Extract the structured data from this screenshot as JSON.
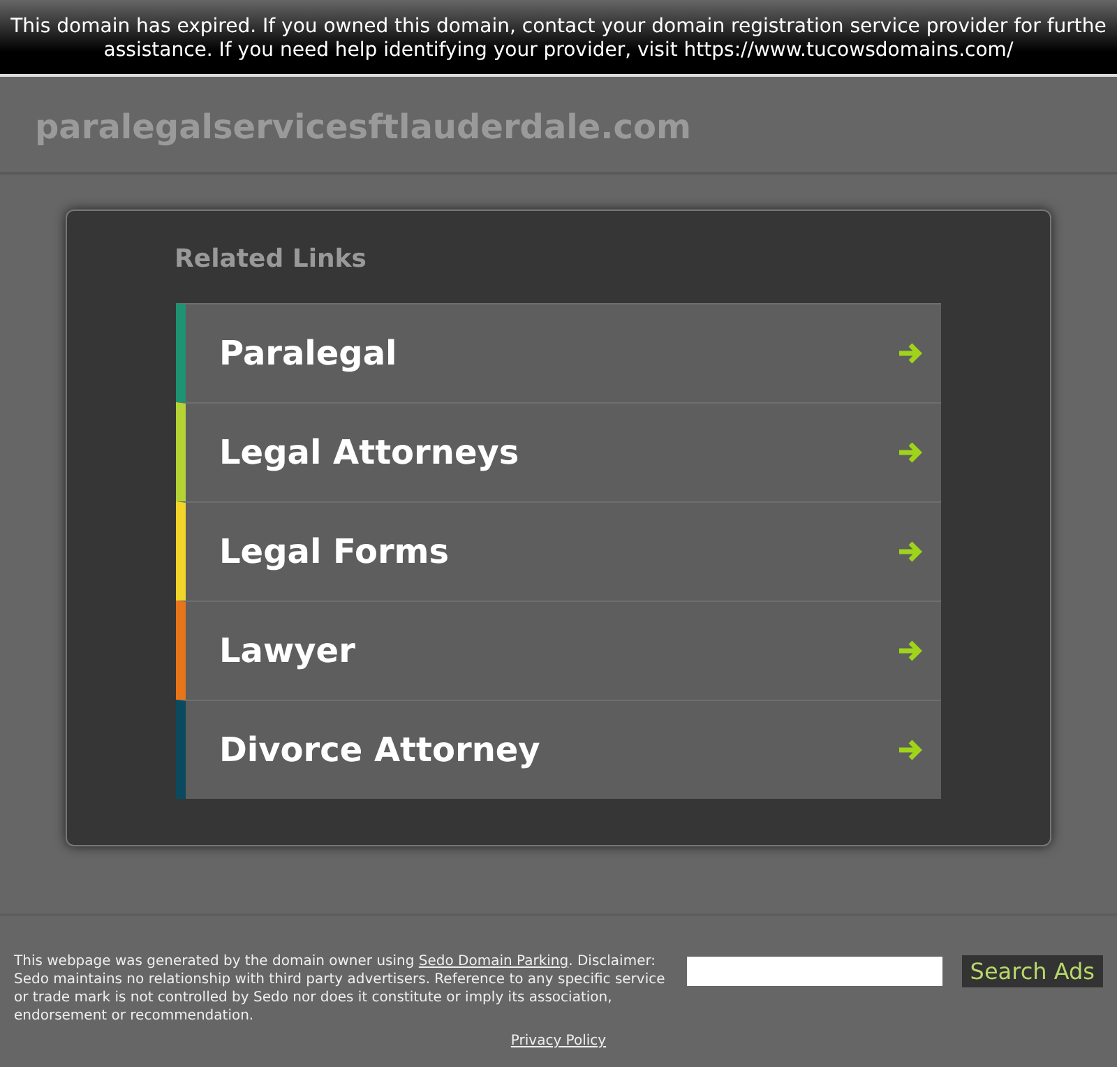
{
  "banner": {
    "lines": [
      "This domain has expired. If you owned this domain, contact your domain registration service provider for furthe",
      "assistance. If you need help identifying your provider, visit https://www.tucowsdomains.com/"
    ]
  },
  "header": {
    "domain": "paralegalservicesftlauderdale.com"
  },
  "related": {
    "title": "Related Links",
    "links": [
      {
        "label": "Paralegal",
        "color": "#1e9273"
      },
      {
        "label": "Legal Attorneys",
        "color": "#b5d334"
      },
      {
        "label": "Legal Forms",
        "color": "#f2d42a"
      },
      {
        "label": "Lawyer",
        "color": "#e8751a"
      },
      {
        "label": "Divorce Attorney",
        "color": "#0b4a5e"
      }
    ]
  },
  "footer": {
    "before": "This webpage was generated by the domain owner using ",
    "link": "Sedo Domain Parking",
    "after": ". Disclaimer: Sedo maintains no relationship with third party advertisers. Reference to any specific service or trade mark is not controlled by Sedo nor does it constitute or imply its association, endorsement or recommendation.",
    "search_button": "Search Ads",
    "privacy": "Privacy Policy"
  }
}
